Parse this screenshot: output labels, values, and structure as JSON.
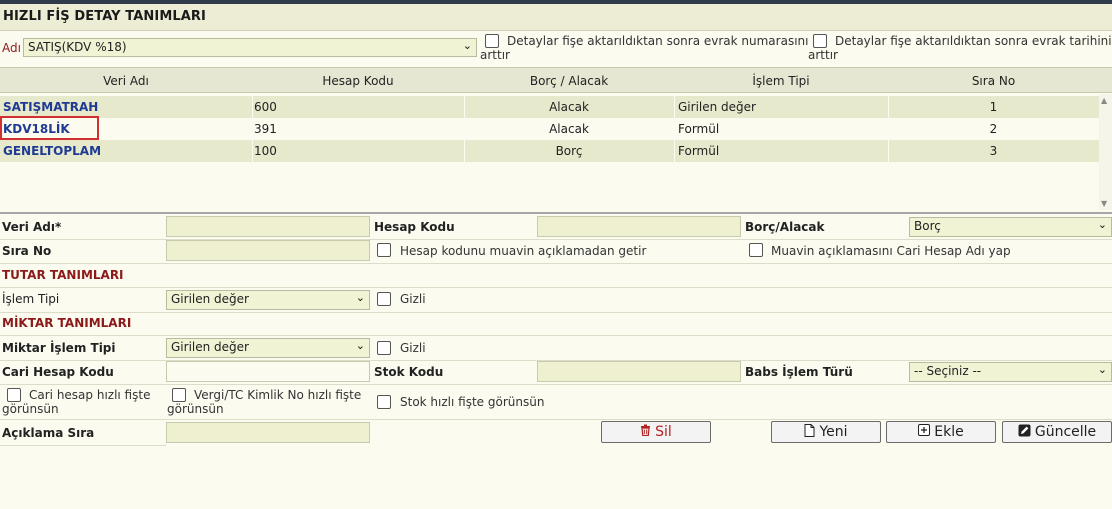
{
  "page_title": "HIZLI FİŞ DETAY TANIMLARI",
  "top": {
    "adi_label": "Adı",
    "adi_value": "SATIŞ(KDV %18)",
    "cb_evrak_no_line1": "Detaylar fişe aktarıldıktan sonra evrak numarasını",
    "cb_evrak_no_line2": "arttır",
    "cb_evrak_tarih_line1": "Detaylar fişe aktarıldıktan sonra evrak tarihini",
    "cb_evrak_tarih_line2": "arttır"
  },
  "grid": {
    "columns": [
      "Veri Adı",
      "Hesap Kodu",
      "Borç / Alacak",
      "İşlem Tipi",
      "Sıra No"
    ],
    "rows": [
      {
        "veri_adi": "SATIŞMATRAH",
        "hesap_kodu": "600",
        "borc_alacak": "Alacak",
        "islem_tipi": "Girilen değer",
        "sira_no": "1"
      },
      {
        "veri_adi": "KDV18LİK",
        "hesap_kodu": "391",
        "borc_alacak": "Alacak",
        "islem_tipi": "Formül",
        "sira_no": "2"
      },
      {
        "veri_adi": "GENELTOPLAM",
        "hesap_kodu": "100",
        "borc_alacak": "Borç",
        "islem_tipi": "Formül",
        "sira_no": "3"
      }
    ]
  },
  "form": {
    "veri_adi_label": "Veri Adı*",
    "hesap_kodu_label": "Hesap Kodu",
    "borc_alacak_label": "Borç/Alacak",
    "borc_alacak_value": "Borç",
    "sira_no_label": "Sıra No",
    "cb_muavin_getir": "Hesap kodunu muavin açıklamadan getir",
    "cb_muavin_cari": "Muavin açıklamasını Cari Hesap Adı yap",
    "tutar_section": "TUTAR TANIMLARI",
    "islem_tipi_label": "İşlem Tipi",
    "islem_tipi_value": "Girilen değer",
    "gizli_label": "Gizli",
    "miktar_section": "MİKTAR TANIMLARI",
    "miktar_islem_tipi_label": "Miktar İşlem Tipi",
    "miktar_islem_tipi_value": "Girilen değer",
    "gizli2_label": "Gizli",
    "cari_hesap_kodu_label": "Cari Hesap Kodu",
    "stok_kodu_label": "Stok Kodu",
    "babs_label": "Babs İşlem Türü",
    "babs_value": "-- Seçiniz --",
    "cb_cari_hizli_line1": "Cari hesap hızlı fişte",
    "cb_cari_hizli_line2": "görünsün",
    "cb_vergi_line1": "Vergi/TC Kimlik No hızlı fişte",
    "cb_vergi_line2": "görünsün",
    "cb_stok_hizli": "Stok hızlı fişte görünsün",
    "aciklama_sira_label": "Açıklama Sıra"
  },
  "buttons": {
    "sil": "Sil",
    "yeni": "Yeni",
    "ekle": "Ekle",
    "guncelle": "Güncelle"
  },
  "colors": {
    "accent_red": "#8b1a1a",
    "link_blue": "#1f3a93",
    "input_bg": "#eef0d0",
    "row_shade": "#e7e9cd"
  },
  "icons": [
    "trash-icon",
    "document-icon",
    "plus-square-icon",
    "edit-icon",
    "chevron-down-icon"
  ]
}
